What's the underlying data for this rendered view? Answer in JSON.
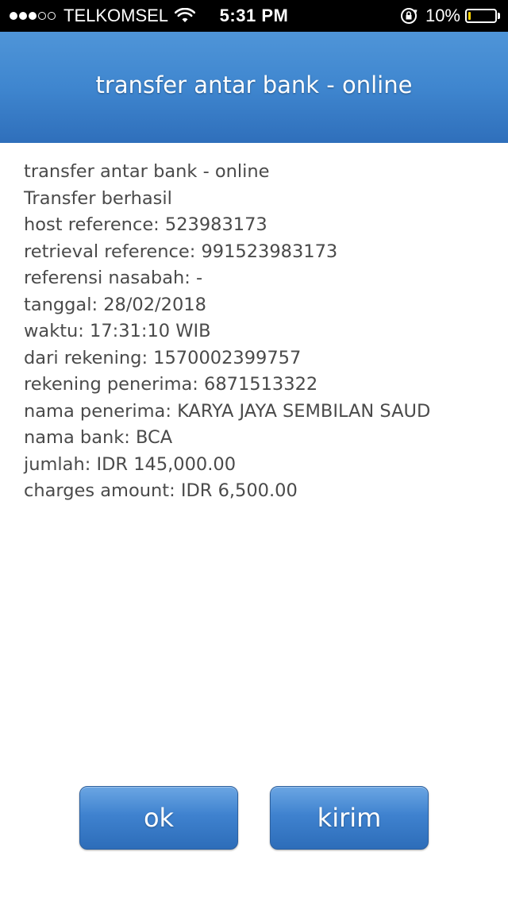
{
  "status_bar": {
    "carrier": "TELKOMSEL",
    "time": "5:31 PM",
    "battery_percent": "10%",
    "battery_level": 0.1,
    "signal_bars_filled": 3,
    "signal_bars_total": 5
  },
  "header": {
    "title": "transfer antar bank - online"
  },
  "details": [
    "transfer antar bank - online",
    "Transfer berhasil",
    "host reference: 523983173",
    "retrieval reference: 991523983173",
    "referensi nasabah: -",
    "tanggal: 28/02/2018",
    "waktu: 17:31:10 WIB",
    "dari rekening: 1570002399757",
    "rekening penerima: 6871513322",
    "nama penerima: KARYA JAYA SEMBILAN SAUD",
    "nama bank: BCA",
    "jumlah: IDR 145,000.00",
    "charges amount: IDR 6,500.00"
  ],
  "buttons": {
    "ok_label": "ok",
    "kirim_label": "kirim"
  },
  "colors": {
    "header_blue": "#3f86cf",
    "button_blue": "#3f82cf",
    "battery_yellow": "#ffd400",
    "text_gray": "#4a4a4a"
  },
  "icons": [
    "signal-dots-icon",
    "wifi-icon",
    "rotation-lock-icon",
    "battery-icon"
  ]
}
